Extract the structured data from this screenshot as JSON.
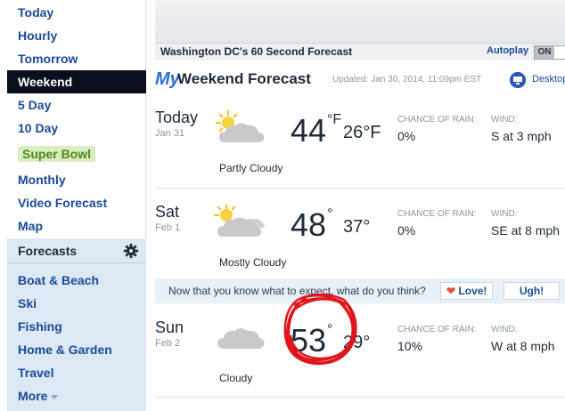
{
  "sidebar": {
    "items": [
      {
        "label": "Today"
      },
      {
        "label": "Hourly"
      },
      {
        "label": "Tomorrow"
      },
      {
        "label": "Weekend"
      },
      {
        "label": "5 Day"
      },
      {
        "label": "10 Day"
      },
      {
        "label": "Super Bowl"
      },
      {
        "label": "Monthly"
      },
      {
        "label": "Video Forecast"
      },
      {
        "label": "Map"
      }
    ],
    "forecasts_heading": "Forecasts",
    "forecasts": [
      {
        "label": "Boat & Beach"
      },
      {
        "label": "Ski"
      },
      {
        "label": "Fishing"
      },
      {
        "label": "Home & Garden"
      },
      {
        "label": "Travel"
      },
      {
        "label": "More"
      }
    ]
  },
  "video": {
    "title": "Washington DC's 60 Second Forecast",
    "autoplay_label": "Autoplay",
    "toggle_on": "ON"
  },
  "header": {
    "my": "My",
    "title": "Weekend Forecast",
    "updated": "Updated: Jan 30, 2014, 11:09pm EST",
    "desktop": "Desktop"
  },
  "labels": {
    "rain": "CHANCE OF RAIN:",
    "wind": "WIND:"
  },
  "days": [
    {
      "day": "Today",
      "date": "Jan 31",
      "condition": "Partly Cloudy",
      "hi": "44",
      "hi_unit": "°F",
      "lo": "26°F",
      "rain": "0%",
      "wind": "S at 3 mph",
      "icon": "sun-cloud-icon"
    },
    {
      "day": "Sat",
      "date": "Feb 1",
      "condition": "Mostly Cloudy",
      "hi": "48",
      "hi_unit": "°",
      "lo": "37°",
      "rain": "0%",
      "wind": "SE at 8 mph",
      "icon": "sun-cloud-icon"
    },
    {
      "day": "Sun",
      "date": "Feb 2",
      "condition": "Cloudy",
      "hi": "53",
      "hi_unit": "°",
      "lo": "29°",
      "rain": "10%",
      "wind": "W at 8 mph",
      "icon": "cloud-icon"
    }
  ],
  "feedback": {
    "text": "Now that you know what to expect, what do you think?",
    "love": "Love!",
    "ugh": "Ugh!"
  },
  "colors": {
    "link": "#1a4b96",
    "active_bg": "#0a0f1e",
    "scribble": "#e0151b"
  }
}
